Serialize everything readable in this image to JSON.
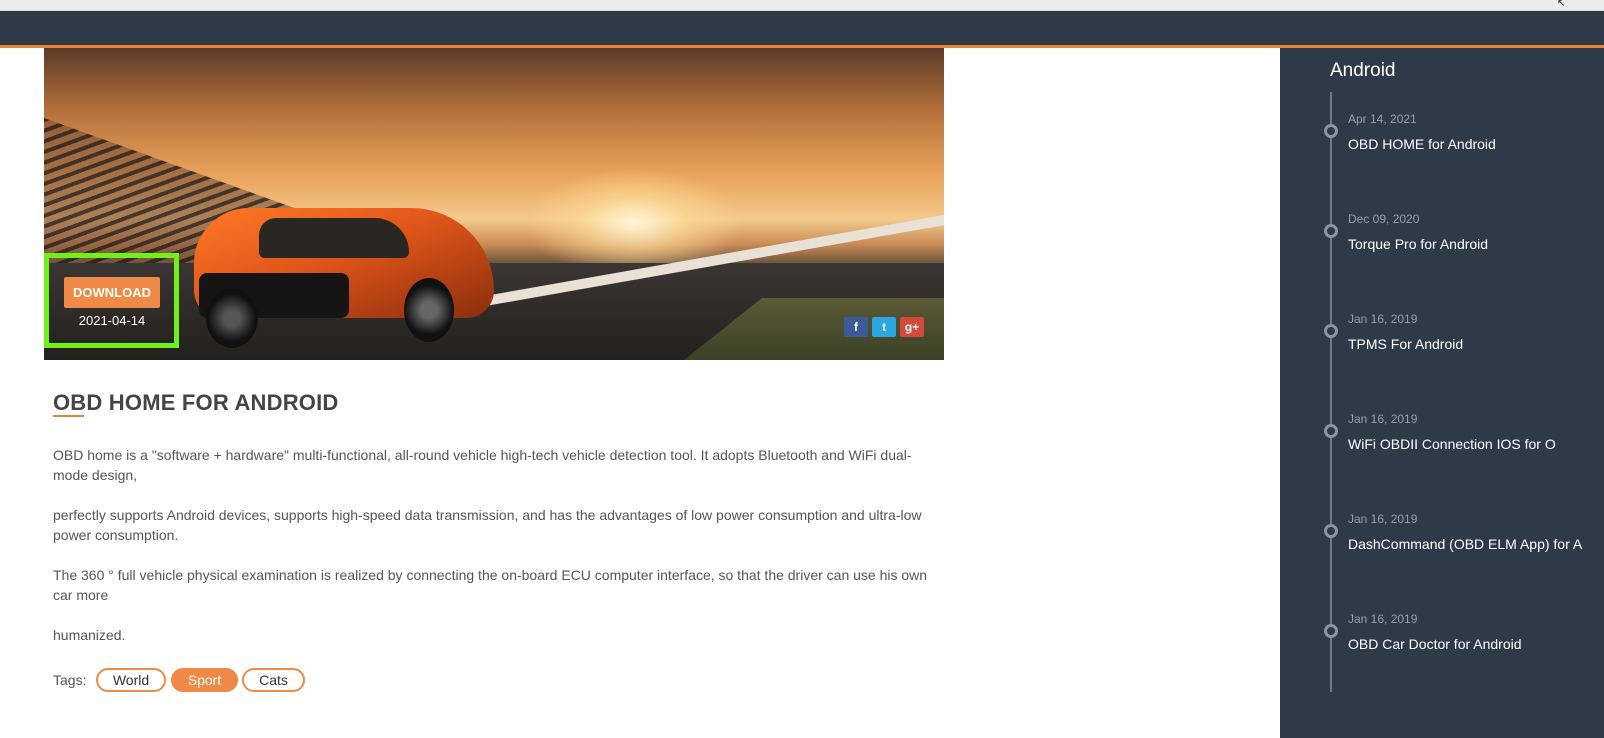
{
  "hero": {
    "download_label": "DOWNLOAD",
    "date": "2021-04-14",
    "share": [
      {
        "icon": "facebook-icon",
        "glyph": "f"
      },
      {
        "icon": "twitter-icon",
        "glyph": "t"
      },
      {
        "icon": "google-plus-icon",
        "glyph": "g+"
      }
    ]
  },
  "article": {
    "title": "OBD HOME FOR ANDROID",
    "paragraphs": [
      "OBD home is a \"software + hardware\" multi-functional, all-round vehicle high-tech vehicle detection tool. It adopts Bluetooth and WiFi dual-mode design,",
      "perfectly supports Android devices, supports high-speed data transmission, and has the advantages of low power consumption and ultra-low power consumption.",
      "The 360 ° full vehicle physical examination is realized by connecting the on-board ECU computer interface, so that the driver can use his own car more",
      "humanized."
    ],
    "tags_label": "Tags:",
    "tags": [
      "World",
      "Sport",
      "Cats"
    ]
  },
  "sidebar": {
    "title": "Android",
    "items": [
      {
        "date": "Apr 14, 2021",
        "title": "OBD HOME for Android"
      },
      {
        "date": "Dec 09, 2020",
        "title": "Torque Pro for Android"
      },
      {
        "date": "Jan 16, 2019",
        "title": "TPMS For Android"
      },
      {
        "date": "Jan 16, 2019",
        "title": "WiFi OBDII Connection IOS for O"
      },
      {
        "date": "Jan 16, 2019",
        "title": "DashCommand (OBD ELM App) for A"
      },
      {
        "date": "Jan 16, 2019",
        "title": "OBD Car Doctor for Android"
      }
    ]
  },
  "colors": {
    "navbar": "#2e3a48",
    "accent": "#e8833a",
    "highlight": "#6ef21a"
  }
}
